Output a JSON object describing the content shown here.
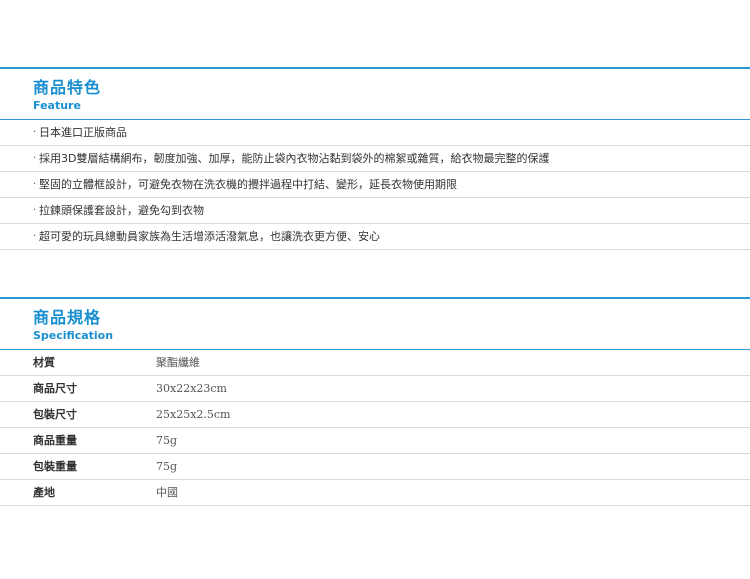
{
  "feature": {
    "title": "商品特色",
    "subtitle": "Feature",
    "bullet": "‧",
    "items": [
      "日本進口正版商品",
      "採用3D雙層結構網布，韌度加強、加厚，能防止袋內衣物沾黏到袋外的棉絮或雜質，給衣物最完整的保護",
      "堅固的立體框設計，可避免衣物在洗衣機的攪拌過程中打結、變形，延長衣物使用期限",
      "拉鍊頭保護套設計，避免勾到衣物",
      "超可愛的玩具總動員家族為生活增添活潑氣息，也讓洗衣更方便、安心"
    ]
  },
  "specification": {
    "title": "商品規格",
    "subtitle": "Specification",
    "rows": [
      {
        "label": "材質",
        "value": "聚酯纖維"
      },
      {
        "label": "商品尺寸",
        "value": "30x22x23cm"
      },
      {
        "label": "包裝尺寸",
        "value": "25x25x2.5cm"
      },
      {
        "label": "商品重量",
        "value": "75g"
      },
      {
        "label": "包裝重量",
        "value": "75g"
      },
      {
        "label": "產地",
        "value": "中國"
      }
    ]
  },
  "colors": {
    "accent": "#1a8fd0",
    "rule": "#2a9ad6",
    "divider": "#d9d9d9"
  }
}
